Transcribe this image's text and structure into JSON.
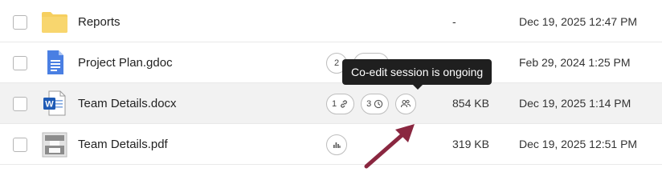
{
  "files": [
    {
      "name": "Reports",
      "type": "folder",
      "size": "-",
      "modified": "Dec 19, 2025 12:47 PM"
    },
    {
      "name": "Project Plan.gdoc",
      "type": "gdoc",
      "links_count": "2",
      "size": "",
      "modified": "Feb 29, 2024 1:25 PM"
    },
    {
      "name": "Team Details.docx",
      "type": "docx",
      "links_count": "1",
      "versions_count": "3",
      "size": "854 KB",
      "modified": "Dec 19, 2025 1:14 PM"
    },
    {
      "name": "Team Details.pdf",
      "type": "pdf",
      "size": "319 KB",
      "modified": "Dec 19, 2025 12:51 PM"
    }
  ],
  "tooltip": {
    "text": "Co-edit session is ongoing"
  },
  "colors": {
    "folder": "#F6CF5F",
    "gdoc": "#4A7FE3",
    "word": "#1F5BB5",
    "highlight_row": "#F2F2F2",
    "tooltip_bg": "#1F1F1F",
    "annotation_arrow": "#8A2740"
  },
  "icons": {
    "folder": "folder-icon",
    "gdoc": "google-doc-icon",
    "docx": "word-doc-icon",
    "pdf": "pdf-icon",
    "links": "link-icon",
    "versions": "clock-icon",
    "coedit": "co-edit-users-icon",
    "stats": "bar-chart-icon"
  }
}
